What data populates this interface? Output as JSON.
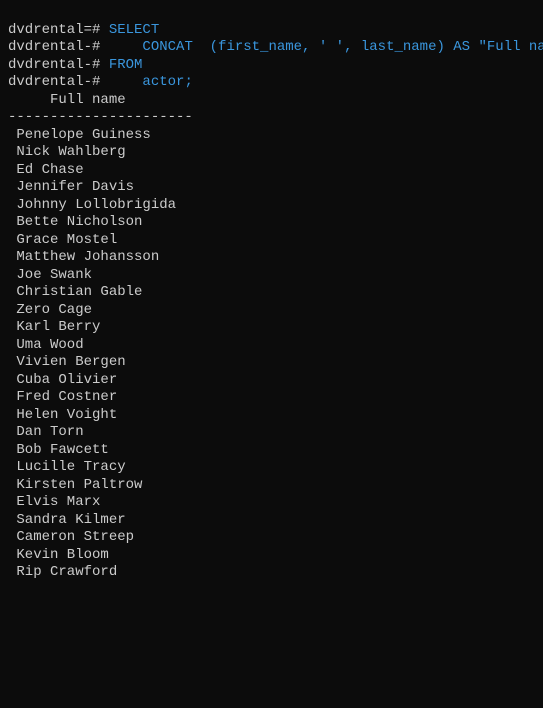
{
  "query": {
    "lines": [
      {
        "prompt": "dvdrental=# ",
        "text": "SELECT"
      },
      {
        "prompt": "dvdrental-# ",
        "text": "    CONCAT  (first_name, ' ', last_name) AS \"Full name\""
      },
      {
        "prompt": "dvdrental-# ",
        "text": "FROM"
      },
      {
        "prompt": "dvdrental-# ",
        "text": "    actor;"
      }
    ]
  },
  "result": {
    "header": "     Full name",
    "separator": "----------------------",
    "rows": [
      " Penelope Guiness",
      " Nick Wahlberg",
      " Ed Chase",
      " Jennifer Davis",
      " Johnny Lollobrigida",
      " Bette Nicholson",
      " Grace Mostel",
      " Matthew Johansson",
      " Joe Swank",
      " Christian Gable",
      " Zero Cage",
      " Karl Berry",
      " Uma Wood",
      " Vivien Bergen",
      " Cuba Olivier",
      " Fred Costner",
      " Helen Voight",
      " Dan Torn",
      " Bob Fawcett",
      " Lucille Tracy",
      " Kirsten Paltrow",
      " Elvis Marx",
      " Sandra Kilmer",
      " Cameron Streep",
      " Kevin Bloom",
      " Rip Crawford"
    ]
  }
}
